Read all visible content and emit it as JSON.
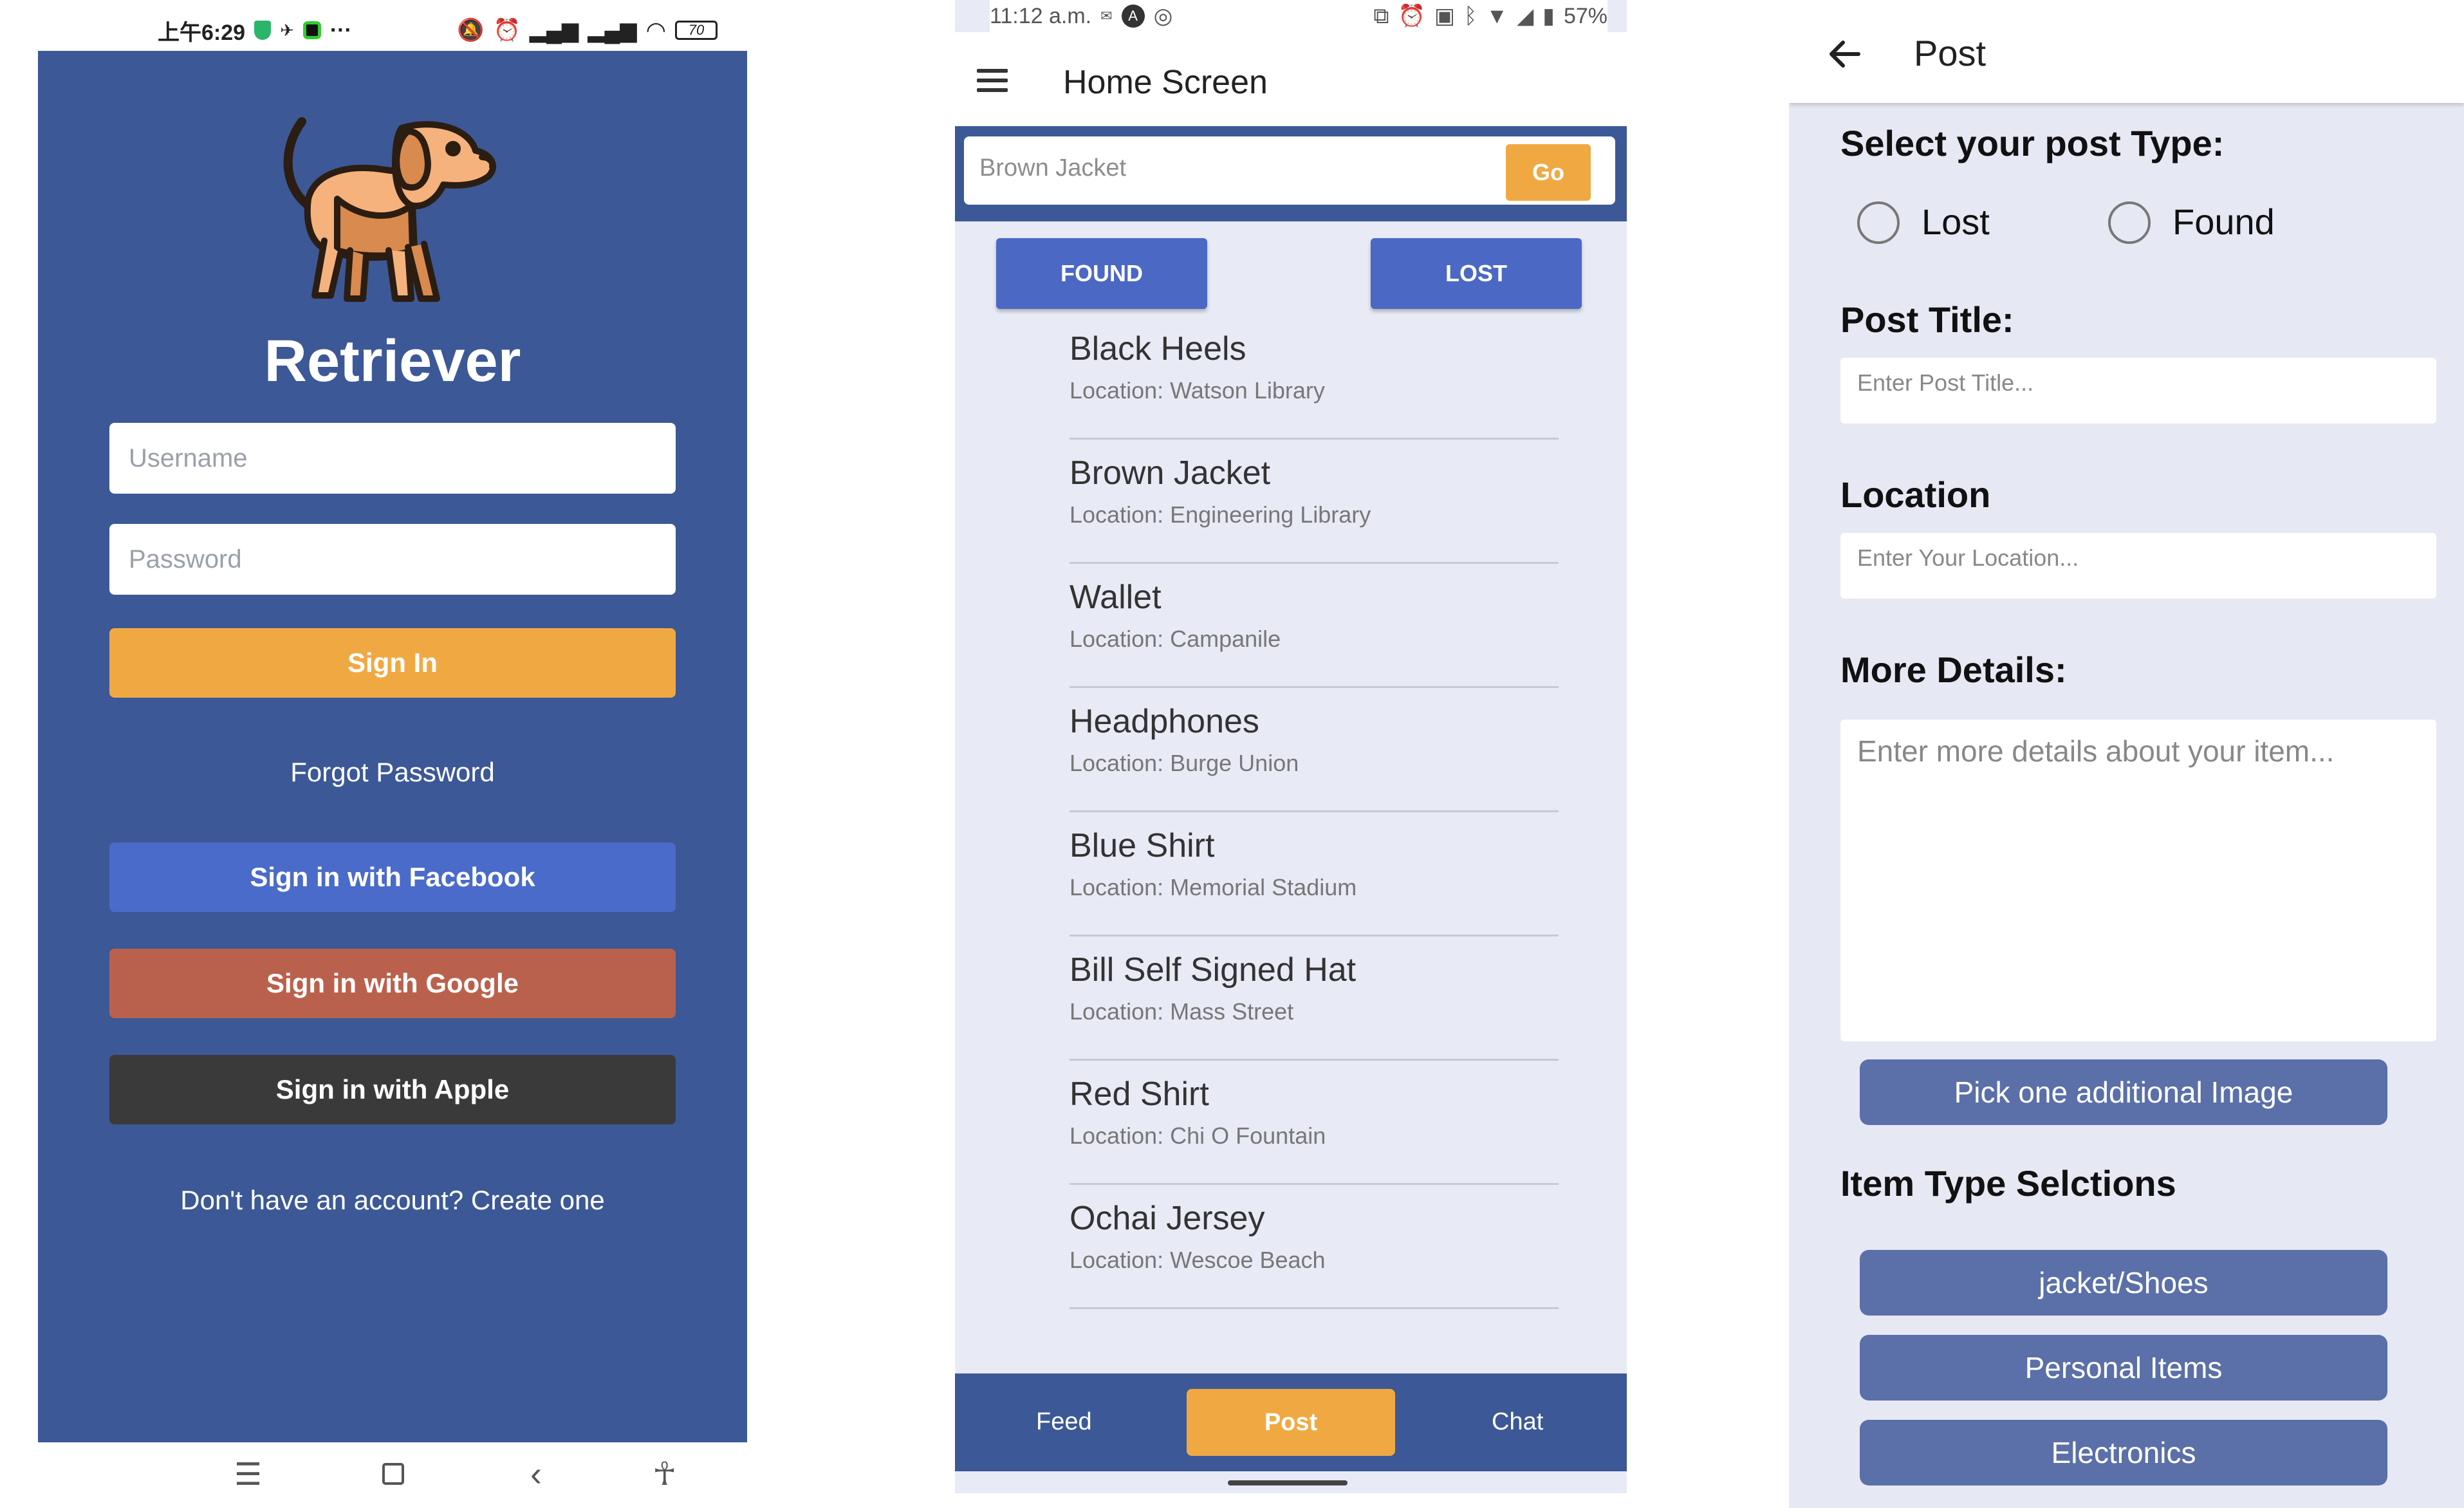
{
  "login": {
    "status": {
      "time": "上午6:29",
      "battery": "70"
    },
    "app_name": "Retriever",
    "username_placeholder": "Username",
    "password_placeholder": "Password",
    "sign_in": "Sign In",
    "forgot_password": "Forgot Password",
    "facebook": "Sign in with Facebook",
    "google": "Sign in with Google",
    "apple": "Sign in with Apple",
    "create_account": "Don't have an account? Create one",
    "colors": {
      "background": "#3c5896",
      "sign_in": "#f0a942",
      "facebook": "#4a6bc9",
      "google": "#ba614d",
      "apple": "#3a3a3a"
    }
  },
  "home": {
    "status": {
      "time": "11:12 a.m.",
      "battery": "57%"
    },
    "title": "Home Screen",
    "search_value": "Brown Jacket",
    "go": "Go",
    "found": "FOUND",
    "lost": "LOST",
    "items": [
      {
        "title": "Black Heels",
        "location": "Location: Watson Library"
      },
      {
        "title": "Brown Jacket",
        "location": "Location: Engineering Library"
      },
      {
        "title": "Wallet",
        "location": "Location: Campanile"
      },
      {
        "title": "Headphones",
        "location": "Location: Burge Union"
      },
      {
        "title": "Blue Shirt",
        "location": "Location: Memorial Stadium"
      },
      {
        "title": "Bill Self Signed Hat",
        "location": "Location: Mass Street"
      },
      {
        "title": "Red Shirt",
        "location": "Location: Chi O Fountain"
      },
      {
        "title": "Ochai Jersey",
        "location": "Location: Wescoe Beach"
      }
    ],
    "nav": {
      "feed": "Feed",
      "post": "Post",
      "chat": "Chat"
    }
  },
  "post": {
    "title": "Post",
    "select_type_label": "Select your post Type:",
    "type_lost": "Lost",
    "type_found": "Found",
    "post_title_label": "Post Title:",
    "post_title_placeholder": "Enter Post Title...",
    "location_label": "Location",
    "location_placeholder": "Enter Your Location...",
    "details_label": "More Details:",
    "details_placeholder": "Enter more details about your item...",
    "pick_image": "Pick one additional Image",
    "item_type_label": "Item Type Selctions",
    "item_types": [
      "jacket/Shoes",
      "Personal Items",
      "Electronics"
    ]
  }
}
